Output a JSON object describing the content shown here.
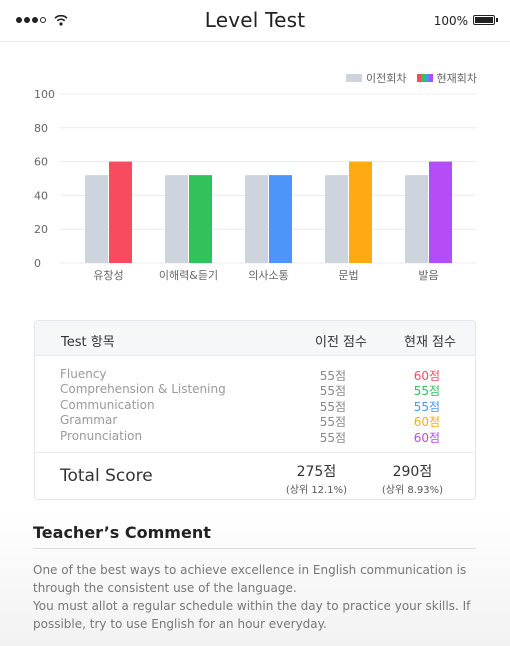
{
  "status_bar": {
    "title": "Level Test",
    "battery": "100%"
  },
  "legend": {
    "previous": "이전회차",
    "current": "현재회차"
  },
  "chart_data": {
    "type": "bar",
    "categories": [
      "유창성",
      "이해력&듣기",
      "의사소통",
      "문법",
      "발음"
    ],
    "series": [
      {
        "name": "이전회차",
        "values": [
          52,
          52,
          52,
          52,
          52
        ],
        "color": "#cdd4de"
      },
      {
        "name": "현재회차",
        "values": [
          60,
          52,
          52,
          60,
          60
        ],
        "colors": [
          "#f84b5f",
          "#32c15a",
          "#4d95f9",
          "#ffaa13",
          "#b44df5"
        ]
      }
    ],
    "ylim": [
      0,
      100
    ],
    "yticks": [
      "0",
      "20",
      "40",
      "60",
      "80",
      "100"
    ],
    "grid": true,
    "legend_position": "top-right"
  },
  "table": {
    "header": {
      "item": "Test 항목",
      "prev": "이전 점수",
      "cur": "현재 점수"
    },
    "rows": [
      {
        "name": "Fluency",
        "prev": "55점",
        "cur": "60점",
        "color": "#f84b5f"
      },
      {
        "name": "Comprehension & Listening",
        "prev": "55점",
        "cur": "55점",
        "color": "#32c15a"
      },
      {
        "name": "Communication",
        "prev": "55점",
        "cur": "55점",
        "color": "#4d95f9"
      },
      {
        "name": "Grammar",
        "prev": "55점",
        "cur": "60점",
        "color": "#ffaa13"
      },
      {
        "name": "Pronunciation",
        "prev": "55점",
        "cur": "60점",
        "color": "#b44df5"
      }
    ],
    "total": {
      "label": "Total Score",
      "prev_score": "275점",
      "prev_rank": "(상위 12.1%)",
      "cur_score": "290점",
      "cur_rank": "(상위 8.93%)"
    }
  },
  "comment": {
    "title": "Teacher’s Comment",
    "text_1": "One of the best ways to achieve excellence in English communication is through the consistent use of the language.",
    "text_2": "You must allot a regular schedule within the day to practice your skills.  If possible, try to use English for an hour everyday."
  }
}
